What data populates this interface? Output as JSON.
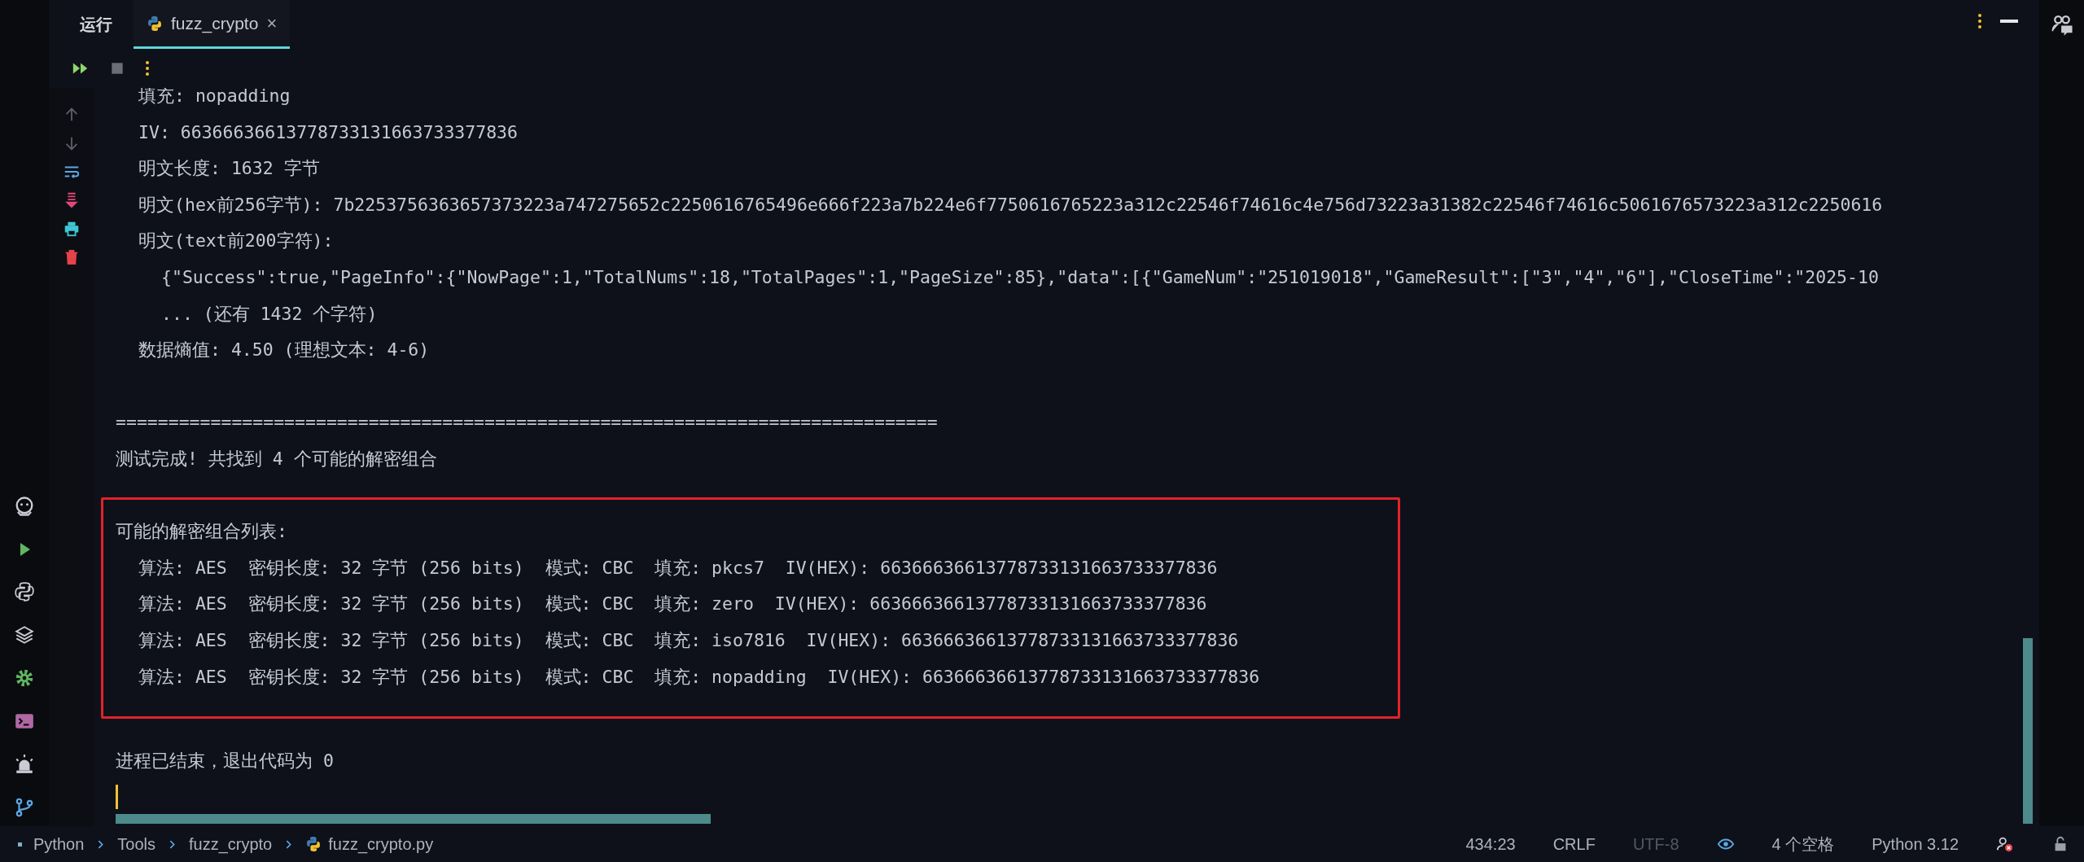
{
  "top_bar": {
    "run_label": "运行",
    "tabs": [
      {
        "label": "fuzz_crypto",
        "selected": true,
        "close": "×"
      }
    ]
  },
  "console": {
    "groups": [
      {
        "highlighted": false,
        "lines": [
          {
            "kind": "item",
            "text": "填充: nopadding"
          },
          {
            "kind": "item",
            "text": "IV: 66366636613778733131663733377836"
          },
          {
            "kind": "item",
            "text": "明文长度: 1632 字节"
          },
          {
            "kind": "item",
            "text": "明文(hex前256字节): 7b2253756363657373223a747275652c2250616765496e666f223a7b224e6f7750616765223a312c22546f74616c4e756d73223a31382c22546f74616c5061676573223a312c2250616"
          },
          {
            "kind": "item",
            "text": "明文(text前200字符):"
          },
          {
            "kind": "sub",
            "text": "{\"Success\":true,\"PageInfo\":{\"NowPage\":1,\"TotalNums\":18,\"TotalPages\":1,\"PageSize\":85},\"data\":[{\"GameNum\":\"251019018\",\"GameResult\":[\"3\",\"4\",\"6\"],\"CloseTime\":\"2025-10"
          },
          {
            "kind": "sub",
            "text": "... (还有 1432 个字符)"
          },
          {
            "kind": "item",
            "text": "数据熵值: 4.50 (理想文本: 4-6)"
          }
        ]
      },
      {
        "highlighted": false,
        "lines": [
          {
            "kind": "plain",
            "text": "=============================================================================="
          },
          {
            "kind": "plain",
            "text": "测试完成! 共找到 4 个可能的解密组合"
          }
        ]
      },
      {
        "highlighted": true,
        "lines": [
          {
            "kind": "plain",
            "text": "可能的解密组合列表:"
          },
          {
            "kind": "item",
            "text": "算法: AES  密钥长度: 32 字节 (256 bits)  模式: CBC  填充: pkcs7  IV(HEX): 66366636613778733131663733377836"
          },
          {
            "kind": "item",
            "text": "算法: AES  密钥长度: 32 字节 (256 bits)  模式: CBC  填充: zero  IV(HEX): 66366636613778733131663733377836"
          },
          {
            "kind": "item",
            "text": "算法: AES  密钥长度: 32 字节 (256 bits)  模式: CBC  填充: iso7816  IV(HEX): 66366636613778733131663733377836"
          },
          {
            "kind": "item",
            "text": "算法: AES  密钥长度: 32 字节 (256 bits)  模式: CBC  填充: nopadding  IV(HEX): 66366636613778733131663733377836"
          }
        ]
      },
      {
        "highlighted": false,
        "lines": [
          {
            "kind": "plain",
            "text": "进程已结束，退出代码为 0"
          }
        ]
      }
    ]
  },
  "status_bar": {
    "breadcrumb": [
      "Python",
      "Tools",
      "fuzz_crypto",
      "fuzz_crypto.py"
    ],
    "items": [
      {
        "kind": "text",
        "text": "434:23",
        "disabled": false
      },
      {
        "kind": "text",
        "text": "CRLF",
        "disabled": false
      },
      {
        "kind": "text",
        "text": "UTF-8",
        "disabled": true
      },
      {
        "kind": "eye"
      },
      {
        "kind": "text",
        "text": "4 个空格",
        "disabled": false
      },
      {
        "kind": "text",
        "text": "Python 3.12",
        "disabled": false
      },
      {
        "kind": "warning"
      },
      {
        "kind": "lock"
      }
    ]
  }
}
